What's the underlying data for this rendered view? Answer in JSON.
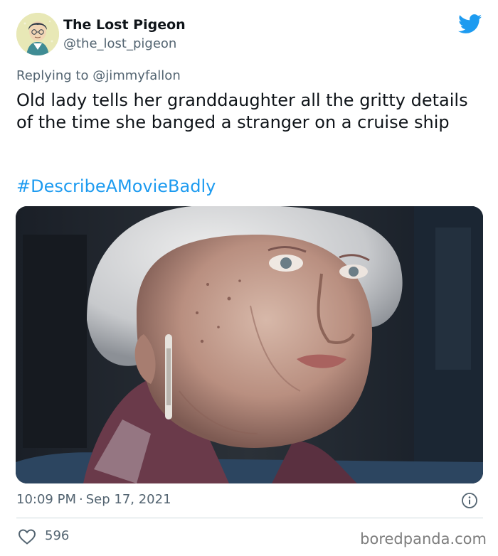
{
  "author": {
    "display_name": "The Lost Pigeon",
    "handle": "@the_lost_pigeon",
    "avatar_icon": "cartoon-face-avatar"
  },
  "reply": {
    "prefix": "Replying to",
    "mention": "@jimmyfallon"
  },
  "tweet": {
    "text": "Old lady tells her granddaughter all the gritty details of the time she banged a stranger on a cruise ship",
    "hashtag": "#DescribeAMovieBadly"
  },
  "meta": {
    "time": "10:09 PM",
    "separator": "·",
    "date": "Sep 17, 2021"
  },
  "engagement": {
    "likes": "596"
  },
  "watermark": "boredpanda.com",
  "colors": {
    "link": "#1d9bf0",
    "secondary_text": "#536471",
    "twitter_brand": "#1d9bf0"
  }
}
